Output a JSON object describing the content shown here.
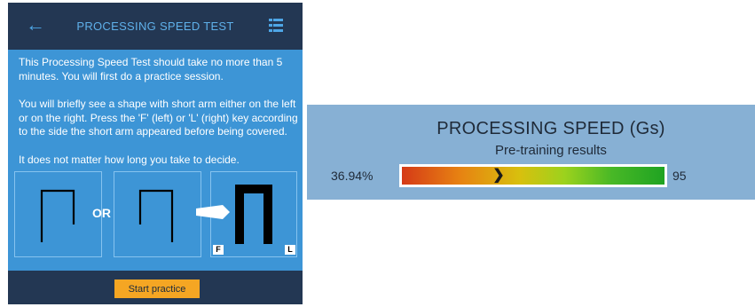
{
  "app": {
    "title": "PROCESSING SPEED TEST",
    "back_icon": "arrow-left-icon",
    "menu_icon": "list-menu-icon"
  },
  "instructions": {
    "paragraph1": "This Processing Speed Test should take no more than 5 minutes. You will first do a practice session.",
    "paragraph2": "You will briefly see a shape with short arm either on the left or on the right. Press the 'F' (left) or 'L' (right) key according to the side the short arm appeared before being covered.",
    "paragraph3": "It does not matter how long you take to decide."
  },
  "illustration": {
    "or_label": "OR",
    "key_left": "F",
    "key_right": "L"
  },
  "footer": {
    "start_label": "Start practice"
  },
  "results": {
    "title": "PROCESSING SPEED (Gs)",
    "subtitle": "Pre-training results",
    "percentile_label": "36.94%",
    "max_label": "95",
    "marker_position_fraction": 0.3694
  },
  "colors": {
    "panel_blue": "#3d95d6",
    "header_navy": "#233753",
    "start_orange": "#f5a623",
    "results_bg": "#87b0d4"
  }
}
